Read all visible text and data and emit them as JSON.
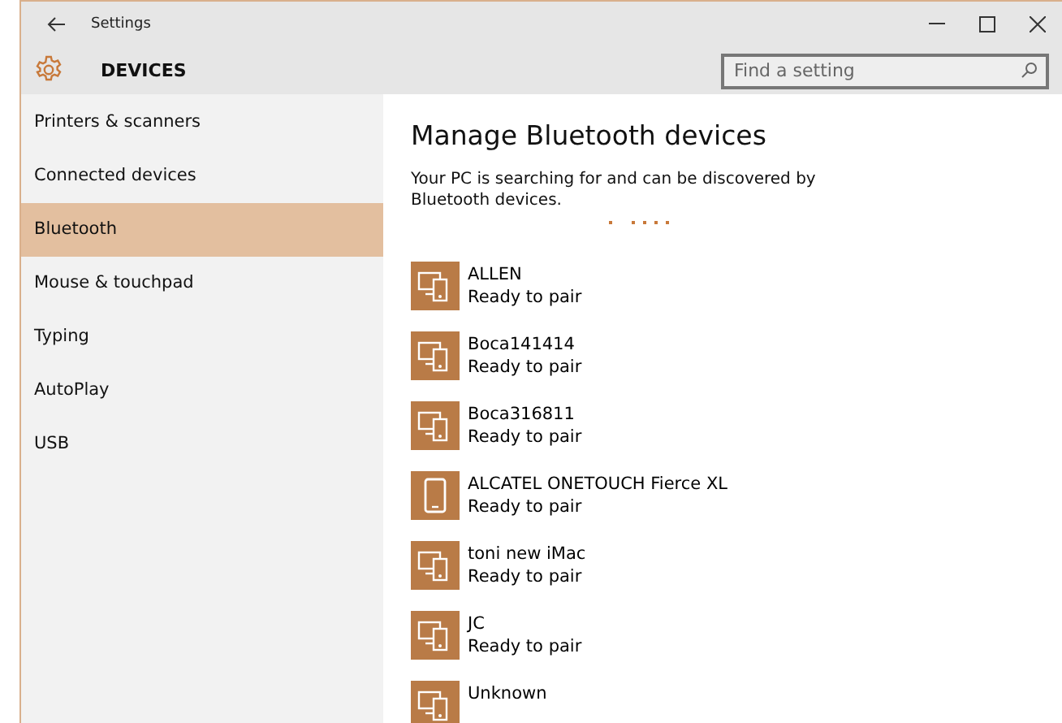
{
  "window": {
    "title": "Settings"
  },
  "header": {
    "title": "DEVICES",
    "search": {
      "placeholder": "Find a setting"
    }
  },
  "sidebar": {
    "items": [
      {
        "label": "Printers & scanners",
        "selected": false
      },
      {
        "label": "Connected devices",
        "selected": false
      },
      {
        "label": "Bluetooth",
        "selected": true
      },
      {
        "label": "Mouse & touchpad",
        "selected": false
      },
      {
        "label": "Typing",
        "selected": false
      },
      {
        "label": "AutoPlay",
        "selected": false
      },
      {
        "label": "USB",
        "selected": false
      }
    ]
  },
  "content": {
    "title": "Manage Bluetooth devices",
    "description": "Your PC is searching for and can be discovered by Bluetooth devices.",
    "devices": [
      {
        "kind": "pc-phone",
        "name": "ALLEN",
        "status": "Ready to pair"
      },
      {
        "kind": "pc-phone",
        "name": "Boca141414",
        "status": "Ready to pair"
      },
      {
        "kind": "pc-phone",
        "name": "Boca316811",
        "status": "Ready to pair"
      },
      {
        "kind": "phone",
        "name": "ALCATEL ONETOUCH Fierce XL",
        "status": "Ready to pair"
      },
      {
        "kind": "pc-phone",
        "name": "toni new iMac",
        "status": "Ready to pair"
      },
      {
        "kind": "pc-phone",
        "name": "JC",
        "status": "Ready to pair"
      },
      {
        "kind": "pc-phone",
        "name": "Unknown"
      }
    ]
  }
}
